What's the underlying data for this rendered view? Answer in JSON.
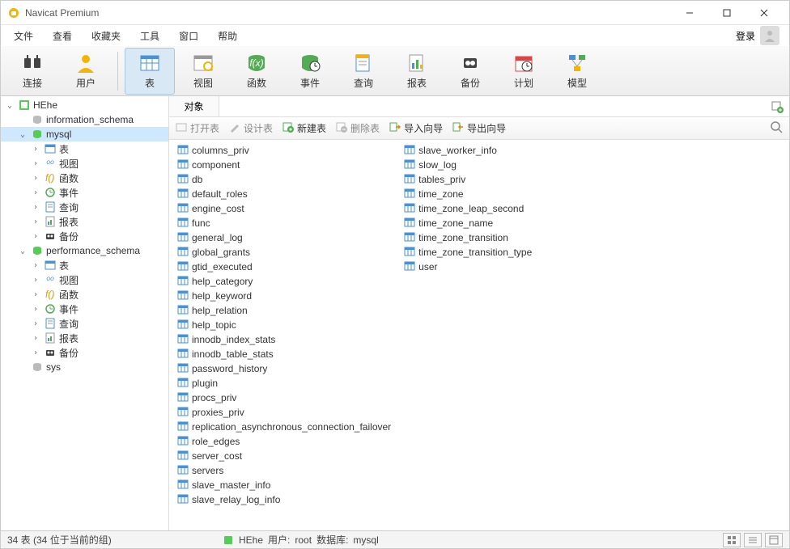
{
  "title": "Navicat Premium",
  "menus": [
    "文件",
    "查看",
    "收藏夹",
    "工具",
    "窗口",
    "帮助"
  ],
  "login": "登录",
  "toolbar": [
    {
      "id": "connect",
      "label": "连接"
    },
    {
      "id": "user",
      "label": "用户"
    },
    {
      "id": "table",
      "label": "表",
      "active": true
    },
    {
      "id": "view",
      "label": "视图"
    },
    {
      "id": "function",
      "label": "函数"
    },
    {
      "id": "event",
      "label": "事件"
    },
    {
      "id": "query",
      "label": "查询"
    },
    {
      "id": "report",
      "label": "报表"
    },
    {
      "id": "backup",
      "label": "备份"
    },
    {
      "id": "schedule",
      "label": "计划"
    },
    {
      "id": "model",
      "label": "模型"
    }
  ],
  "tree": [
    {
      "d": 0,
      "exp": "v",
      "type": "conn",
      "label": "HEhe"
    },
    {
      "d": 1,
      "exp": "",
      "type": "db-off",
      "label": "information_schema"
    },
    {
      "d": 1,
      "exp": "v",
      "type": "db",
      "label": "mysql",
      "selected": true
    },
    {
      "d": 2,
      "exp": ">",
      "type": "tbl",
      "label": "表"
    },
    {
      "d": 2,
      "exp": ">",
      "type": "view",
      "label": "视图"
    },
    {
      "d": 2,
      "exp": ">",
      "type": "func",
      "label": "函数"
    },
    {
      "d": 2,
      "exp": ">",
      "type": "event",
      "label": "事件"
    },
    {
      "d": 2,
      "exp": ">",
      "type": "query",
      "label": "查询"
    },
    {
      "d": 2,
      "exp": ">",
      "type": "report",
      "label": "报表"
    },
    {
      "d": 2,
      "exp": ">",
      "type": "backup",
      "label": "备份"
    },
    {
      "d": 1,
      "exp": "v",
      "type": "db",
      "label": "performance_schema"
    },
    {
      "d": 2,
      "exp": ">",
      "type": "tbl",
      "label": "表"
    },
    {
      "d": 2,
      "exp": ">",
      "type": "view",
      "label": "视图"
    },
    {
      "d": 2,
      "exp": ">",
      "type": "func",
      "label": "函数"
    },
    {
      "d": 2,
      "exp": ">",
      "type": "event",
      "label": "事件"
    },
    {
      "d": 2,
      "exp": ">",
      "type": "query",
      "label": "查询"
    },
    {
      "d": 2,
      "exp": ">",
      "type": "report",
      "label": "报表"
    },
    {
      "d": 2,
      "exp": ">",
      "type": "backup",
      "label": "备份"
    },
    {
      "d": 1,
      "exp": "",
      "type": "db-off",
      "label": "sys"
    }
  ],
  "obj_tab": "对象",
  "actions": [
    {
      "label": "打开表",
      "enabled": false,
      "icon": "open"
    },
    {
      "label": "设计表",
      "enabled": false,
      "icon": "design"
    },
    {
      "label": "新建表",
      "enabled": true,
      "icon": "new"
    },
    {
      "label": "删除表",
      "enabled": false,
      "icon": "delete"
    },
    {
      "label": "导入向导",
      "enabled": true,
      "icon": "import"
    },
    {
      "label": "导出向导",
      "enabled": true,
      "icon": "export"
    }
  ],
  "tables_col1": [
    "columns_priv",
    "component",
    "db",
    "default_roles",
    "engine_cost",
    "func",
    "general_log",
    "global_grants",
    "gtid_executed",
    "help_category",
    "help_keyword",
    "help_relation",
    "help_topic",
    "innodb_index_stats",
    "innodb_table_stats",
    "password_history",
    "plugin",
    "procs_priv",
    "proxies_priv",
    "replication_asynchronous_connection_failover",
    "role_edges",
    "server_cost",
    "servers",
    "slave_master_info",
    "slave_relay_log_info"
  ],
  "tables_col2": [
    "slave_worker_info",
    "slow_log",
    "tables_priv",
    "time_zone",
    "time_zone_leap_second",
    "time_zone_name",
    "time_zone_transition",
    "time_zone_transition_type",
    "user"
  ],
  "status": {
    "count": "34 表 (34 位于当前的组)",
    "conn": "HEhe",
    "user_label": "用户:",
    "user": "root",
    "db_label": "数据库:",
    "db": "mysql"
  }
}
